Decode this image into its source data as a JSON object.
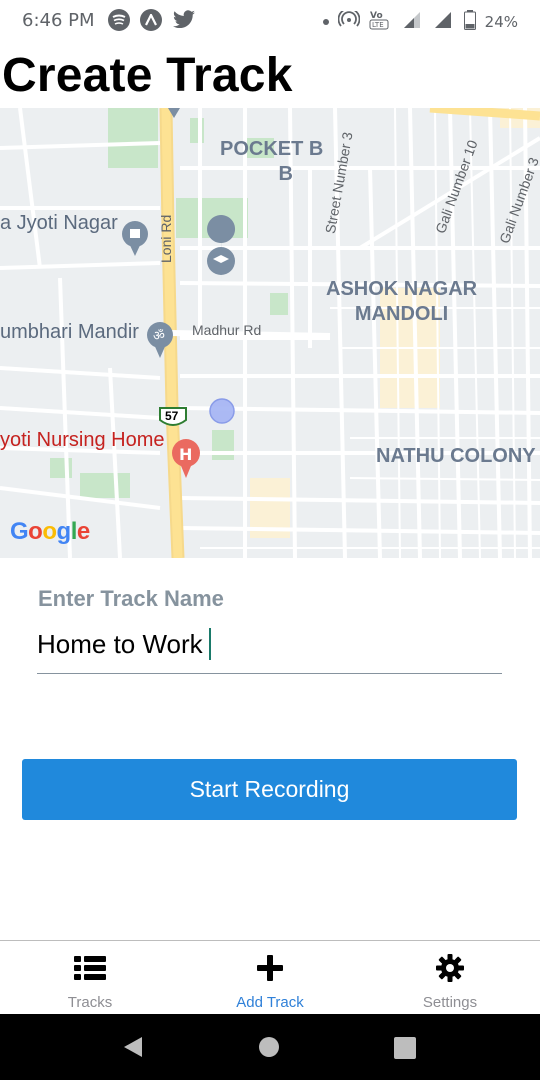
{
  "status_bar": {
    "time": "6:46 PM",
    "battery": "24%",
    "icons": [
      "spotify-icon",
      "app-icon",
      "twitter-icon",
      "hotspot-icon",
      "volte-icon",
      "signal-icon",
      "battery-icon"
    ]
  },
  "header": {
    "title": "Create Track"
  },
  "map": {
    "areas": [
      "POCKET B\nB",
      "ASHOK NAGAR\nMANDOLI",
      "NATHU COLONY"
    ],
    "places": [
      "a Jyoti Nagar",
      "umbhari Mandir",
      "yoti Nursing Home"
    ],
    "roads": [
      "Loni Rd",
      "Madhur Rd",
      "Street Number 3",
      "Gali Number 10",
      "Gali Number 3"
    ],
    "highway_badge": "57",
    "logo": "Google"
  },
  "form": {
    "label": "Enter Track Name",
    "value": "Home to Work",
    "button_label": "Start Recording"
  },
  "tabs": [
    {
      "label": "Tracks",
      "icon": "list-icon",
      "active": false
    },
    {
      "label": "Add Track",
      "icon": "plus-icon",
      "active": true
    },
    {
      "label": "Settings",
      "icon": "gear-icon",
      "active": false
    }
  ],
  "colors": {
    "accent": "#2089dc",
    "active_tab": "#2f80d8",
    "label": "#86939e"
  }
}
